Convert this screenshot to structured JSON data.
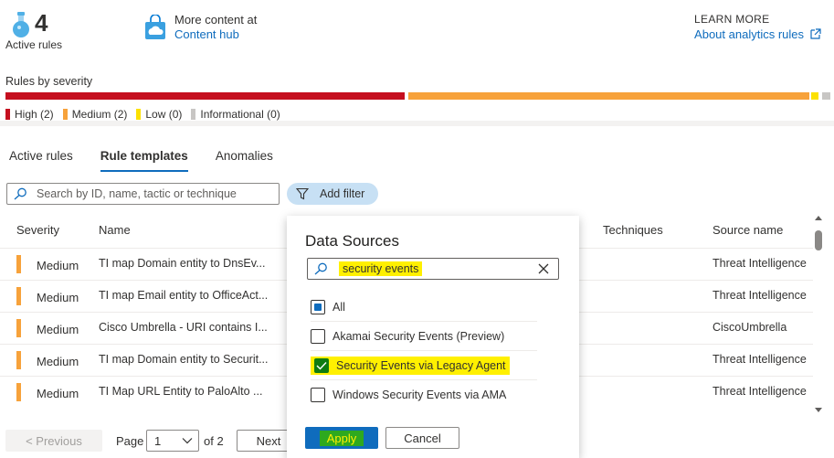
{
  "summary": {
    "active_count": "4",
    "active_label": "Active rules",
    "more_content_title": "More content at",
    "more_content_link": "Content hub",
    "learn_more_title": "LEARN MORE",
    "learn_more_link": "About analytics rules"
  },
  "severity": {
    "title": "Rules by severity",
    "legend": [
      {
        "label": "High (2)",
        "color": "#c50f1f"
      },
      {
        "label": "Medium (2)",
        "color": "#f7a23b"
      },
      {
        "label": "Low (0)",
        "color": "#fce100"
      },
      {
        "label": "Informational (0)",
        "color": "#c8c6c4"
      }
    ]
  },
  "tabs": [
    {
      "label": "Active rules",
      "active": false
    },
    {
      "label": "Rule templates",
      "active": true
    },
    {
      "label": "Anomalies",
      "active": false
    }
  ],
  "search": {
    "placeholder": "Search by ID, name, tactic or technique"
  },
  "filter_button": "Add filter",
  "table": {
    "headers": {
      "severity": "Severity",
      "name": "Name",
      "techniques": "Techniques",
      "source": "Source name"
    },
    "rows": [
      {
        "severity": "Medium",
        "name": "TI map Domain entity to DnsEv...",
        "source": "Threat Intelligence"
      },
      {
        "severity": "Medium",
        "name": "TI map Email entity to OfficeAct...",
        "source": "Threat Intelligence"
      },
      {
        "severity": "Medium",
        "name": "Cisco Umbrella - URI contains I...",
        "source": "CiscoUmbrella"
      },
      {
        "severity": "Medium",
        "name": "TI map Domain entity to Securit...",
        "source": "Threat Intelligence"
      },
      {
        "severity": "Medium",
        "name": "TI Map URL Entity to PaloAlto ...",
        "source": "Threat Intelligence"
      }
    ]
  },
  "pager": {
    "previous": "< Previous",
    "page_label": "Page",
    "page_value": "1",
    "of_label": "of 2",
    "next": "Next"
  },
  "dropdown": {
    "title": "Data Sources",
    "search_value": "security events",
    "options": [
      {
        "label": "All",
        "state": "partial"
      },
      {
        "label": "Akamai Security Events (Preview)",
        "state": "unchecked"
      },
      {
        "label": "Security Events via Legacy Agent",
        "state": "checked"
      },
      {
        "label": "Windows Security Events via AMA",
        "state": "unchecked"
      }
    ],
    "apply": "Apply",
    "cancel": "Cancel"
  }
}
